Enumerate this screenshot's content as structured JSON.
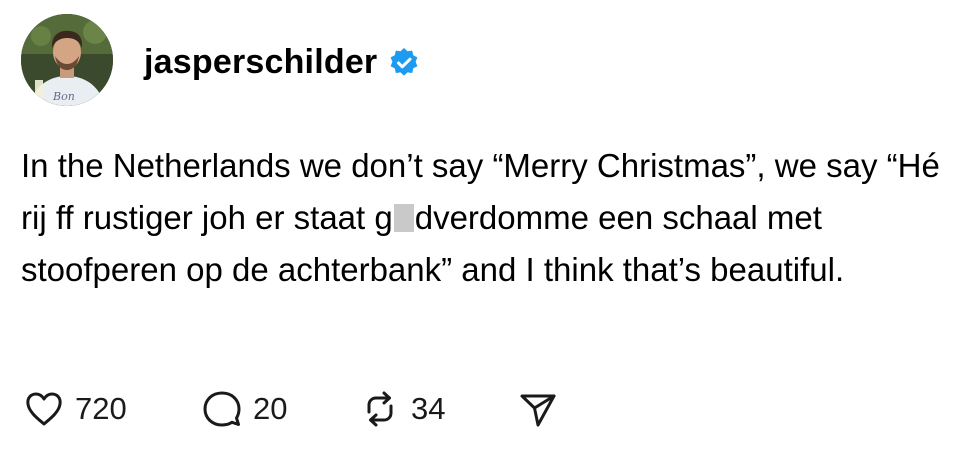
{
  "post": {
    "username": "jasperschilder",
    "verified": true,
    "avatar_icon": "profile-photo",
    "text_before_censor": "In the Netherlands we don’t say “Merry Christmas”, we say “Hé rij ff rustiger joh er staat g",
    "text_after_censor": "dverdomme een schaal met stoofperen op de achterbank” and I think that’s beautiful.",
    "actions": {
      "likes": "720",
      "replies": "20",
      "reposts": "34"
    }
  },
  "colors": {
    "verified_badge": "#1d9bf0",
    "censor_block": "#c9c9c9",
    "text": "#000000"
  },
  "icons": {
    "like": "heart-icon",
    "reply": "speech-bubble-icon",
    "repost": "repost-arrows-icon",
    "share": "paper-plane-icon",
    "verified": "verified-badge-icon"
  }
}
